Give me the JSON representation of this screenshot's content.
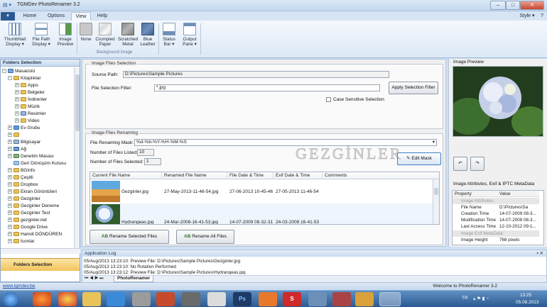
{
  "window": {
    "title": "TGMDev PhotoRenamer 3.2",
    "style_label": "Style"
  },
  "tabs": [
    "Home",
    "Options",
    "View",
    "Help"
  ],
  "ribbon": {
    "buttons": [
      {
        "label1": "ThumbNail",
        "label2": "Display"
      },
      {
        "label1": "File Path",
        "label2": "Display"
      },
      {
        "label1": "Image",
        "label2": "Preview"
      },
      {
        "label1": "None",
        "label2": ""
      },
      {
        "label1": "Crumpled",
        "label2": "Paper"
      },
      {
        "label1": "Scratched",
        "label2": "Metal"
      },
      {
        "label1": "Blue",
        "label2": "Leather"
      },
      {
        "label1": "Status",
        "label2": "Bar"
      },
      {
        "label1": "Output",
        "label2": "Pane"
      }
    ],
    "group_label": "Background Image"
  },
  "folders": {
    "header": "Folders Selection",
    "nav_label": "Folders Selection",
    "tree": [
      "Masaüstü",
      "Kitaplıklar",
      "Apps",
      "Belgeler",
      "İndirenler",
      "Müzik",
      "Resimler",
      "Video",
      "Ev Grubu",
      "",
      "Bilgisayar",
      "Ağ",
      "Denetim Masası",
      "Geri Dönüşüm Kutusu",
      "BGInfo",
      "Çeşitli",
      "Dropbox",
      "Ekran Görüntüleri",
      "Gezginler",
      "Gezginler Deneme",
      "Gezginler Test",
      "gezginler.net",
      "Google Drive",
      "Hamdi DÖNDÜREN",
      "İconlar"
    ]
  },
  "selection": {
    "legend": "Image Files Selection",
    "source_label": "Source Path:",
    "source_value": "D:\\Pictures\\Sample Pictures",
    "filter_label": "File Selection Filter:",
    "filter_value": "*.jpg",
    "apply_button": "Apply Selection Filter",
    "case_label": "Case Sensitive Selection"
  },
  "renaming": {
    "legend": "Image Files Renaming",
    "mask_label": "File Renaming Mask:",
    "mask_value": "%d-%b-%Y-%H-%M-%S",
    "listed_label": "Number of Files Listed:",
    "listed_value": "10",
    "selected_label": "Number of Files Selected:",
    "selected_value": "1",
    "edit_button": "Edit Mask",
    "columns": [
      "Current File Name",
      "Renamed File Name",
      "File Date & Time",
      "Exif Date & Time",
      "Comments"
    ],
    "rows": [
      {
        "current": "Gezginler.jpg",
        "renamed": "27-May-2013-11-46-54.jpg",
        "file_dt": "27-06-2013 10-45-46",
        "exif_dt": "27-05-2013 11-46-54"
      },
      {
        "current": "Hydrangeas.jpg",
        "renamed": "24-Mar-2008-16-41-53.jpg",
        "file_dt": "14-07-2009 08-32-31",
        "exif_dt": "24-03-2008 16-41-53"
      }
    ],
    "rename_selected": "Rename Selected Files",
    "rename_all": "Rename All Files"
  },
  "watermark": "GEZGİNLER",
  "preview": {
    "header": "Image Preview"
  },
  "metadata": {
    "header": "Image Attributes, Exif & IPTC MetaData",
    "col_property": "Property",
    "col_value": "Value",
    "cat1": "Image Attributes",
    "rows": [
      {
        "k": "File Name",
        "v": "D:\\Pictures\\Sa"
      },
      {
        "k": "Creation Time",
        "v": "14-07-2009 08-3..."
      },
      {
        "k": "Modification Time",
        "v": "14-07-2009 08-3..."
      },
      {
        "k": "Last Access Time",
        "v": "12-10-2012 09-1..."
      }
    ],
    "cat2": "Image Exif MetaData",
    "height_k": "Image Height",
    "height_v": "768 pixels"
  },
  "log": {
    "header": "Application Log",
    "lines": [
      "05/Aug/2013 13:23:10: Preview File: D:\\Pictures\\Sample Pictures\\Gezginler.jpg",
      "05/Aug/2013 13:23:10: No Rotation Performed",
      "05/Aug/2013 13:23:12: Preview File: D:\\Pictures\\Sample Pictures\\Hydrangeas.jpg"
    ],
    "tab": "PhotoRenamer"
  },
  "status": {
    "left": "www.tgmdev.be",
    "right": "Welcome to PhotoRenamer 3.2"
  },
  "taskbar": {
    "lang": "TR",
    "time": "13:25",
    "date": "05.08.2013"
  },
  "colors": {
    "accent": "#2b5a92",
    "ribbon": "#dde9f6"
  }
}
